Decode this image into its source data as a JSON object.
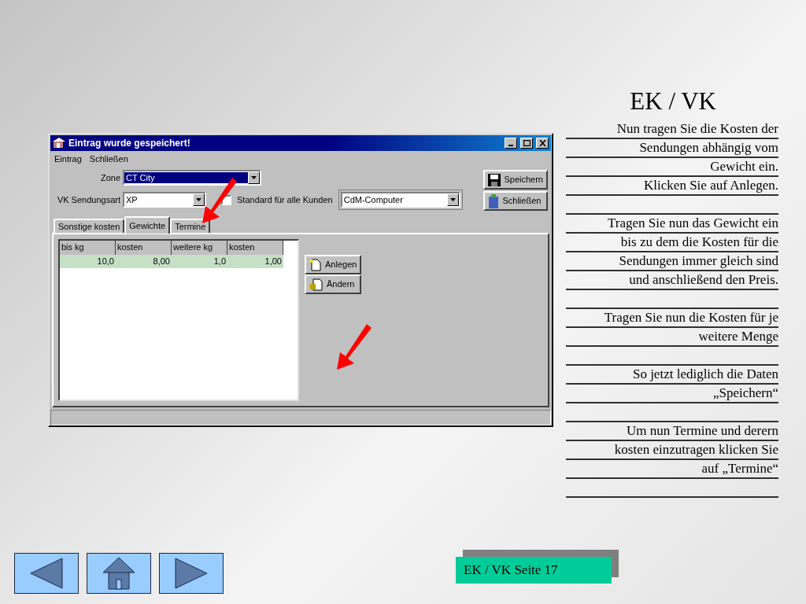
{
  "slide_title": "EK / VK",
  "window": {
    "title": "Eintrag wurde gespeichert!",
    "menu": [
      "Eintrag",
      "Schließen"
    ],
    "zone": {
      "label": "Zone",
      "value": "CT City"
    },
    "sendungsart": {
      "label": "VK Sendungsart",
      "value": "XP"
    },
    "standard": {
      "label": "Standard für alle Kunden",
      "checked": false
    },
    "kunde": {
      "value": "CdM-Computer"
    },
    "side_buttons": [
      "Speichern",
      "Schließen"
    ],
    "tabs": [
      {
        "label": "Sonstige kosten",
        "selected": false
      },
      {
        "label": "Gewichte",
        "selected": true
      },
      {
        "label": "Termine",
        "selected": false
      }
    ],
    "table": {
      "columns": [
        "bis kg",
        "kosten",
        "weitere kg",
        "kosten"
      ],
      "rows": [
        {
          "cells": [
            "10,0",
            "8,00",
            "1,0",
            "1,00"
          ],
          "selected": true
        }
      ]
    },
    "panel_buttons": [
      "Anlegen",
      "Ändern"
    ]
  },
  "instructions": [
    [
      "Nun tragen Sie die Kosten der",
      "Sendungen abhängig vom",
      "Gewicht ein.",
      "Klicken Sie auf Anlegen."
    ],
    [
      "Tragen Sie nun das Gewicht ein",
      "bis zu dem die Kosten für die",
      "Sendungen immer gleich sind",
      "und anschließend den Preis."
    ],
    [
      "Tragen Sie nun die Kosten für je",
      "weitere Menge"
    ],
    [
      "So jetzt lediglich die Daten",
      "„Speichern“"
    ],
    [
      "Um nun Termine und derern",
      "kosten einzutragen klicken Sie",
      "auf „Termine“"
    ]
  ],
  "page_label": "EK / VK Seite 17"
}
